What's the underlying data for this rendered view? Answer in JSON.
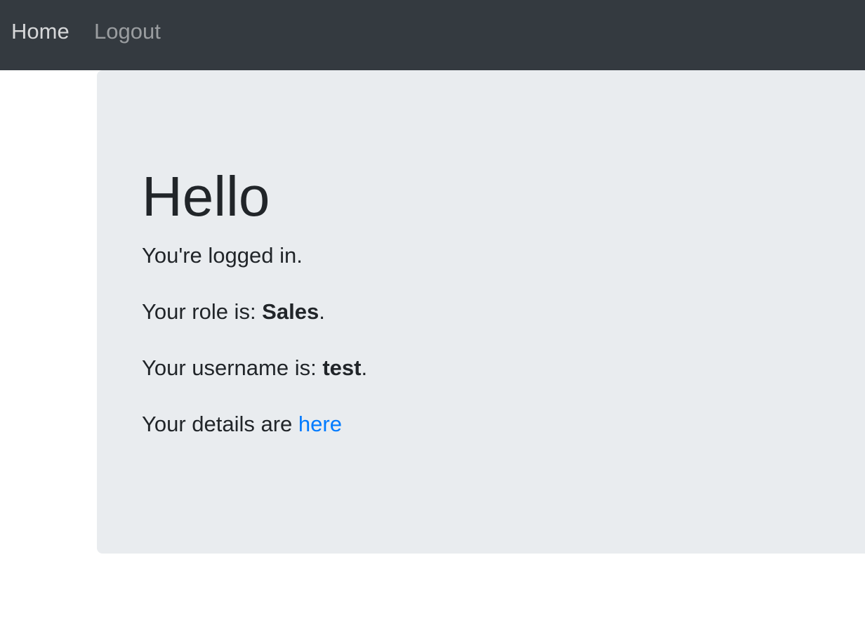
{
  "navbar": {
    "home_label": "Home",
    "logout_label": "Logout"
  },
  "main": {
    "title": "Hello",
    "logged_in_text": "You're logged in.",
    "role_prefix": "Your role is: ",
    "role_value": "Sales",
    "role_suffix": ".",
    "username_prefix": "Your username is: ",
    "username_value": "test",
    "username_suffix": ".",
    "details_prefix": "Your details are ",
    "details_link": "here"
  },
  "colors": {
    "navbar_bg": "#343a40",
    "jumbotron_bg": "#e9ecef",
    "text": "#212529",
    "link": "#007bff"
  }
}
